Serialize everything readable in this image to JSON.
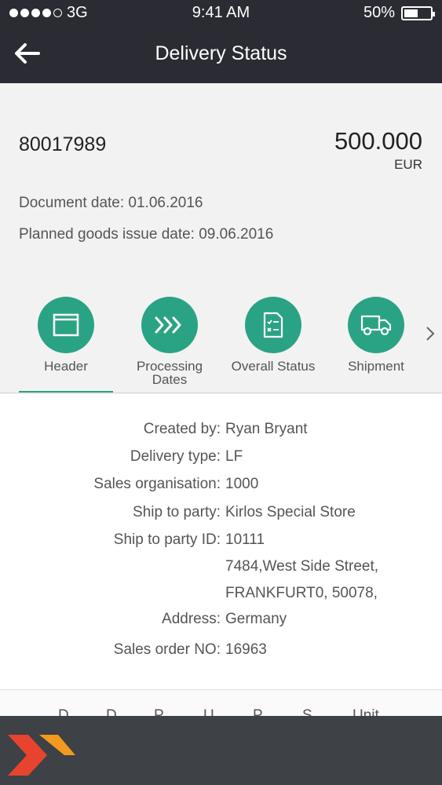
{
  "status_bar": {
    "carrier": "3G",
    "time": "9:41 AM",
    "battery": "50%",
    "battery_level": 0.5
  },
  "nav": {
    "title": "Delivery Status",
    "back_icon": "arrow-left-icon"
  },
  "summary": {
    "document_number": "80017989",
    "amount": "500.000",
    "currency": "EUR",
    "document_date": "Document date: 01.06.2016",
    "planned_goods_issue_date": "Planned goods issue date: 09.06.2016"
  },
  "tabs": [
    {
      "label": "Header",
      "icon": "window-icon",
      "selected": true
    },
    {
      "label": "Processing Dates",
      "icon": "fast-forward-icon",
      "selected": false
    },
    {
      "label": "Overall Status",
      "icon": "checklist-icon",
      "selected": false
    },
    {
      "label": "Shipment",
      "icon": "truck-icon",
      "selected": false
    }
  ],
  "details": {
    "created_by": {
      "label": "Created by:",
      "value": "Ryan Bryant"
    },
    "delivery_type": {
      "label": "Delivery type:",
      "value": "LF"
    },
    "sales_org": {
      "label": "Sales organisation:",
      "value": "1000"
    },
    "ship_to_party": {
      "label": "Ship to party:",
      "value": "Kirlos Special Store"
    },
    "ship_to_party_id": {
      "label": "Ship to party ID:",
      "value": "10111"
    },
    "address": {
      "label": "Address:",
      "line1": "7484,West Side Street,",
      "line2": "FRANKFURT0, 50078,",
      "line3": "Germany"
    },
    "sales_order_no": {
      "label": "Sales order NO:",
      "value": "16963"
    }
  },
  "table": {
    "columns": [
      "D",
      "D",
      "P",
      "U",
      "P",
      "S",
      "Unit"
    ]
  },
  "colors": {
    "accent": "#2aa384",
    "header_bg": "#2b2b33",
    "bottom_bar": "#3e4146",
    "logo_red": "#e8432e",
    "logo_orange": "#f39a1e"
  }
}
